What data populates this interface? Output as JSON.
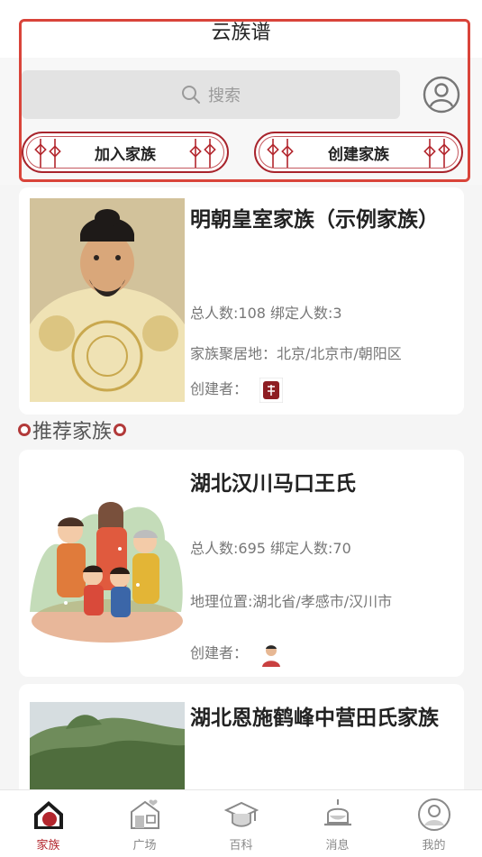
{
  "header": {
    "title": "云族谱",
    "search_placeholder": "搜索",
    "join_label": "加入家族",
    "create_label": "创建家族"
  },
  "featured": {
    "name": "明朝皇室家族（示例家族）",
    "stats": "总人数:108 绑定人数:3",
    "location": "家族聚居地：北京/北京市/朝阳区",
    "creator_label": "创建者："
  },
  "recommend_title": "推荐家族",
  "families": [
    {
      "name": "湖北汉川马口王氏",
      "stats": "总人数:695 绑定人数:70",
      "location": "地理位置:湖北省/孝感市/汉川市",
      "creator_label": "创建者："
    },
    {
      "name": "湖北恩施鹤峰中营田氏家族"
    }
  ],
  "nav": [
    {
      "label": "家族",
      "icon": "home-icon",
      "active": true
    },
    {
      "label": "广场",
      "icon": "shop-icon",
      "active": false
    },
    {
      "label": "百科",
      "icon": "graduation-cap-icon",
      "active": false
    },
    {
      "label": "消息",
      "icon": "bell-icon",
      "active": false
    },
    {
      "label": "我的",
      "icon": "user-icon",
      "active": false
    }
  ],
  "colors": {
    "accent": "#b3262d",
    "highlight": "#d9443a"
  }
}
